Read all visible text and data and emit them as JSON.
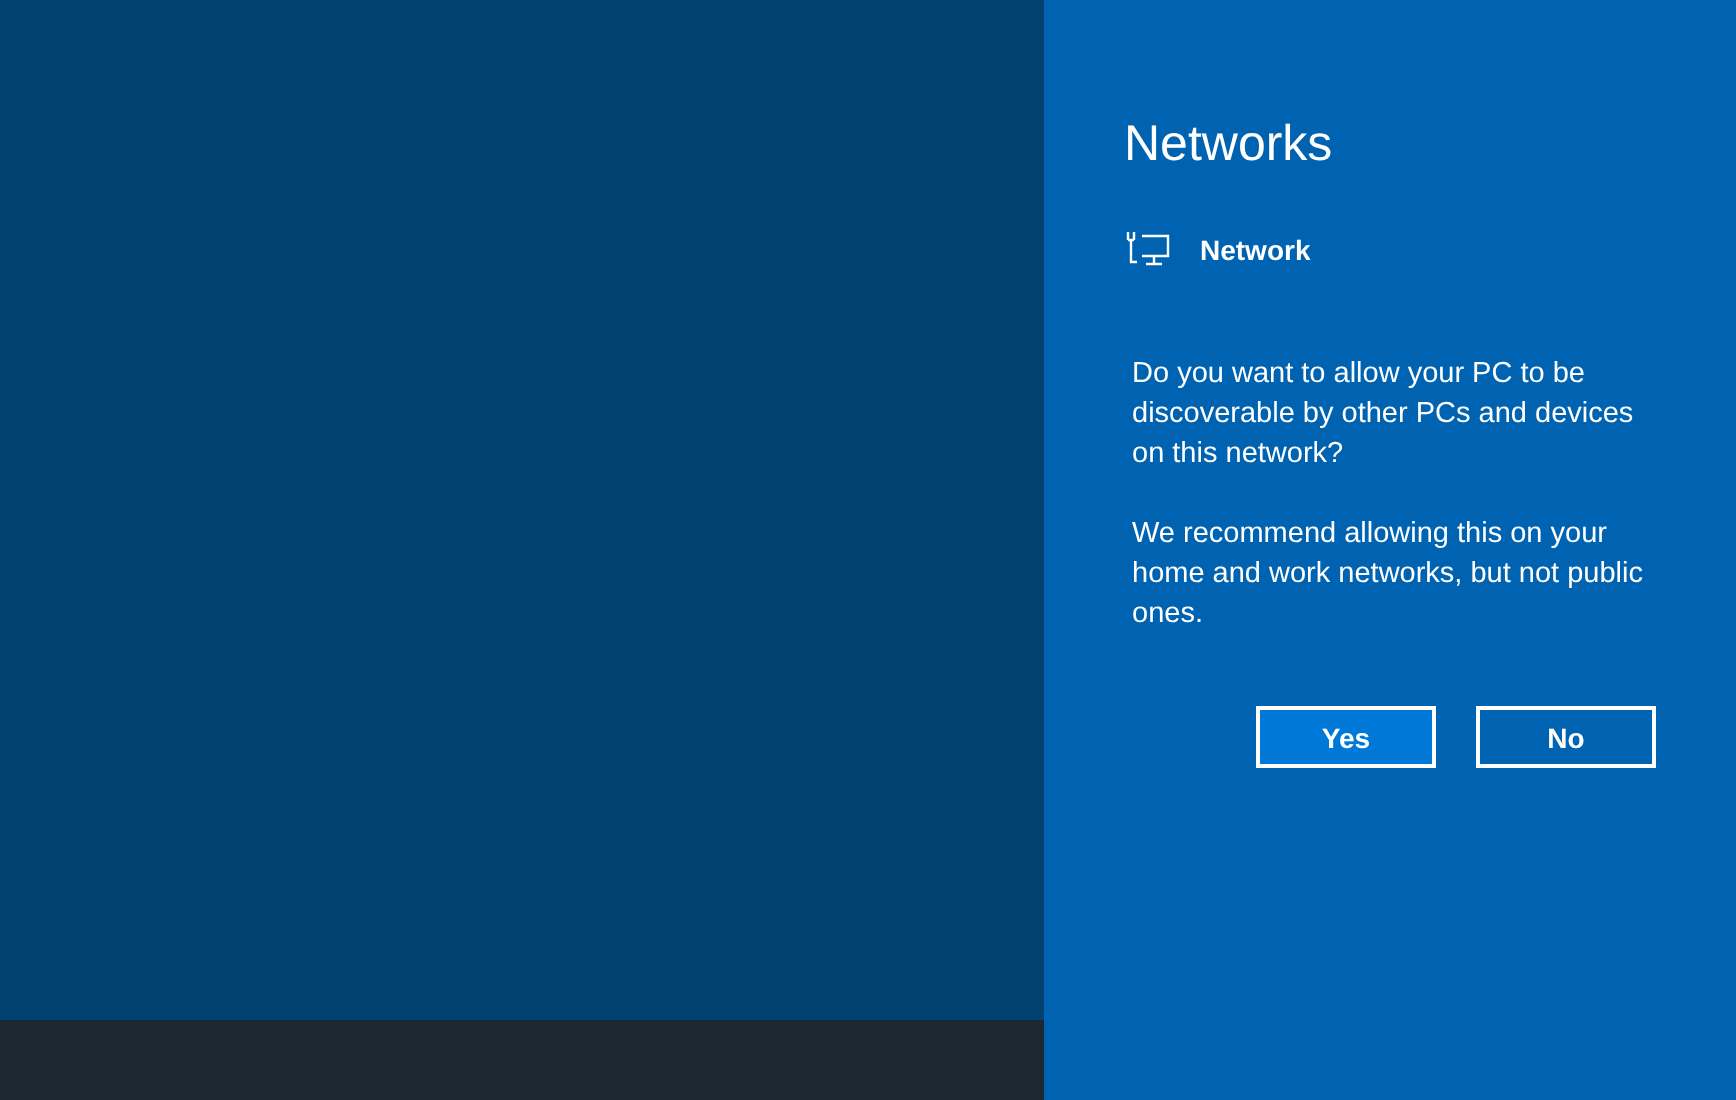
{
  "panel": {
    "title": "Networks",
    "network": {
      "name": "Network"
    },
    "paragraphs": [
      "Do you want to allow your PC to be discoverable by other PCs and devices on this network?",
      "We recommend allowing this on your home and work networks, but not public ones."
    ],
    "buttons": [
      {
        "label": "Yes",
        "kind": "primary"
      },
      {
        "label": "No",
        "kind": "secondary"
      }
    ]
  }
}
